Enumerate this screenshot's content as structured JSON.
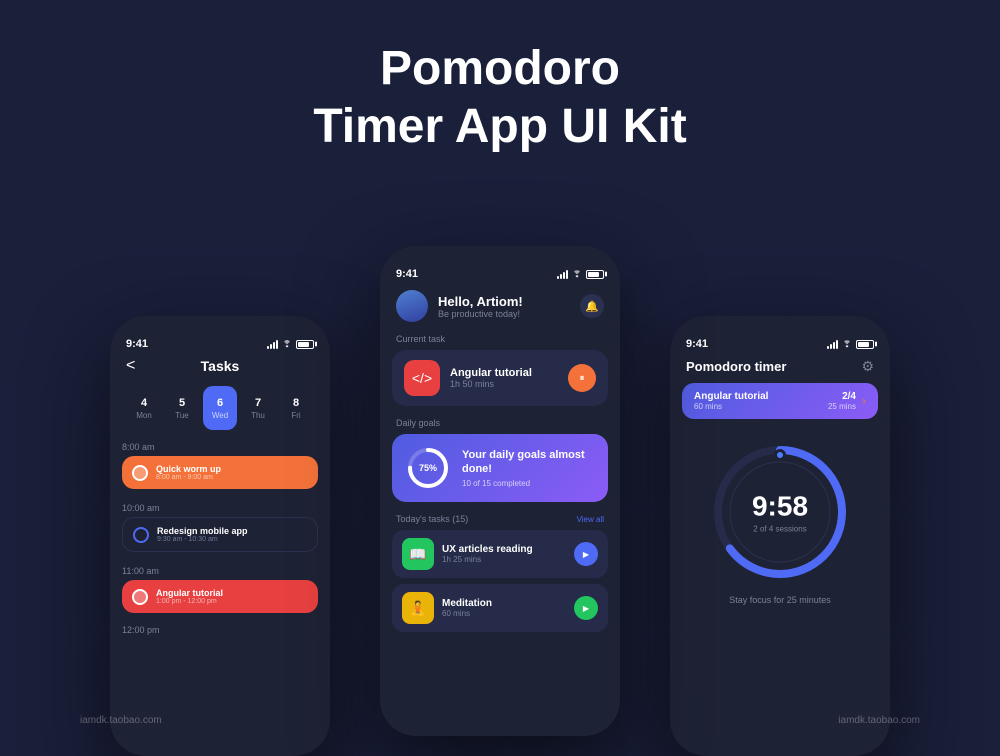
{
  "header": {
    "line1": "Pomodoro",
    "line2": "Timer App UI  Kit"
  },
  "watermarks": {
    "left": "iamdk.taobao.com",
    "right": "iamdk.taobao.com"
  },
  "phone_left": {
    "status": {
      "time": "9:41"
    },
    "title": "Tasks",
    "back": "<",
    "dates": [
      {
        "day": "4",
        "label": "Mon"
      },
      {
        "day": "5",
        "label": "Tue"
      },
      {
        "day": "6",
        "label": "Wed",
        "active": true
      },
      {
        "day": "7",
        "label": "Thu"
      },
      {
        "day": "8",
        "label": "Fri"
      }
    ],
    "sections": [
      {
        "time_label": "8:00 am",
        "tasks": [
          {
            "name": "Quick worm up",
            "time_range": "8:00 am - 9:00 am",
            "color": "orange"
          }
        ]
      },
      {
        "time_label": "10:00 am",
        "tasks": [
          {
            "name": "Redesign mobile app",
            "time_range": "9:30 am - 10:30 am",
            "color": "outline"
          }
        ]
      },
      {
        "time_label": "11:00 am",
        "tasks": [
          {
            "name": "Angular tutorial",
            "time_range": "1:00 pm - 12:00 pm",
            "color": "red"
          }
        ]
      }
    ]
  },
  "phone_center": {
    "status": {
      "time": "9:41"
    },
    "greeting": {
      "hello": "Hello, Artiom!",
      "sub": "Be productive today!"
    },
    "current_task_label": "Current task",
    "current_task": {
      "name": "Angular tutorial",
      "duration": "1h 50 mins"
    },
    "daily_goals_label": "Daily goals",
    "daily_goals": {
      "percent": "75%",
      "title": "Your daily goals almost done!",
      "sub": "10 of 15 completed"
    },
    "todays_tasks_label": "Today's tasks (15)",
    "view_all": "View all",
    "tasks": [
      {
        "name": "UX articles reading",
        "duration": "1h 25 mins",
        "icon": "📖",
        "color": "green"
      },
      {
        "name": "Meditation",
        "duration": "60 mins",
        "icon": "🧘",
        "color": "yellow"
      }
    ]
  },
  "phone_right": {
    "status": {
      "time": "9:41"
    },
    "title": "Pomodoro timer",
    "current_task": {
      "name": "Angular tutorial",
      "duration": "60 mins",
      "progress": "2/4",
      "remaining": "25 mins"
    },
    "timer": {
      "time": "9:58",
      "sessions": "2 of 4 sessions",
      "progress_percent": 65
    },
    "stay_focus": "Stay focus for 25 minutes"
  }
}
